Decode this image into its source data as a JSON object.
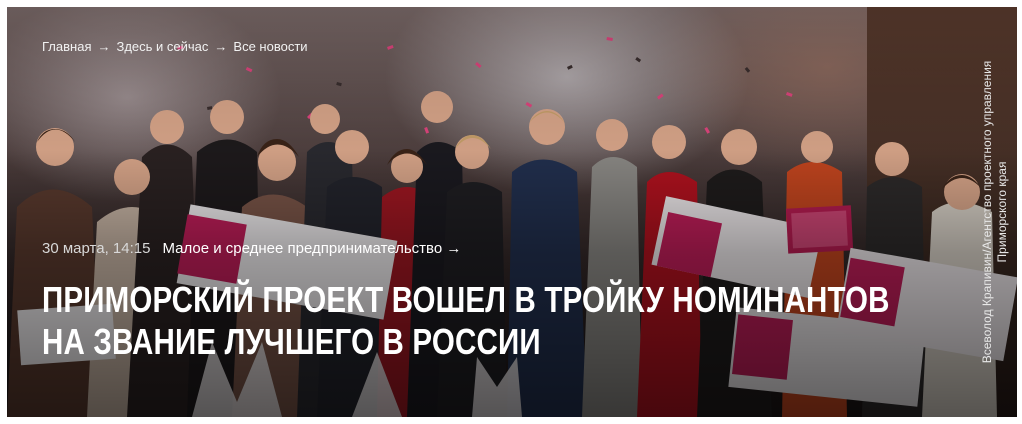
{
  "breadcrumb": {
    "items": [
      "Главная",
      "Здесь и сейчас",
      "Все новости"
    ],
    "separator": "→"
  },
  "article": {
    "date": "30 марта, 14:15",
    "rubric": "Малое и среднее предпринимательство →",
    "title_lines": [
      "ПРИМОРСКИЙ ПРОЕКТ ВОШЕЛ В ТРОЙКУ НОМИНАНТОВ",
      "НА ЗВАНИЕ ЛУЧШЕГО В РОССИИ"
    ]
  },
  "photo": {
    "credit_lines": [
      "Всеволод Крапивин/Агентство проектного управления",
      "Приморского края"
    ]
  },
  "colors": {
    "title_text": "#ffffff",
    "meta_text": "#d8d8d8",
    "accent_pink": "#c21e5a"
  }
}
